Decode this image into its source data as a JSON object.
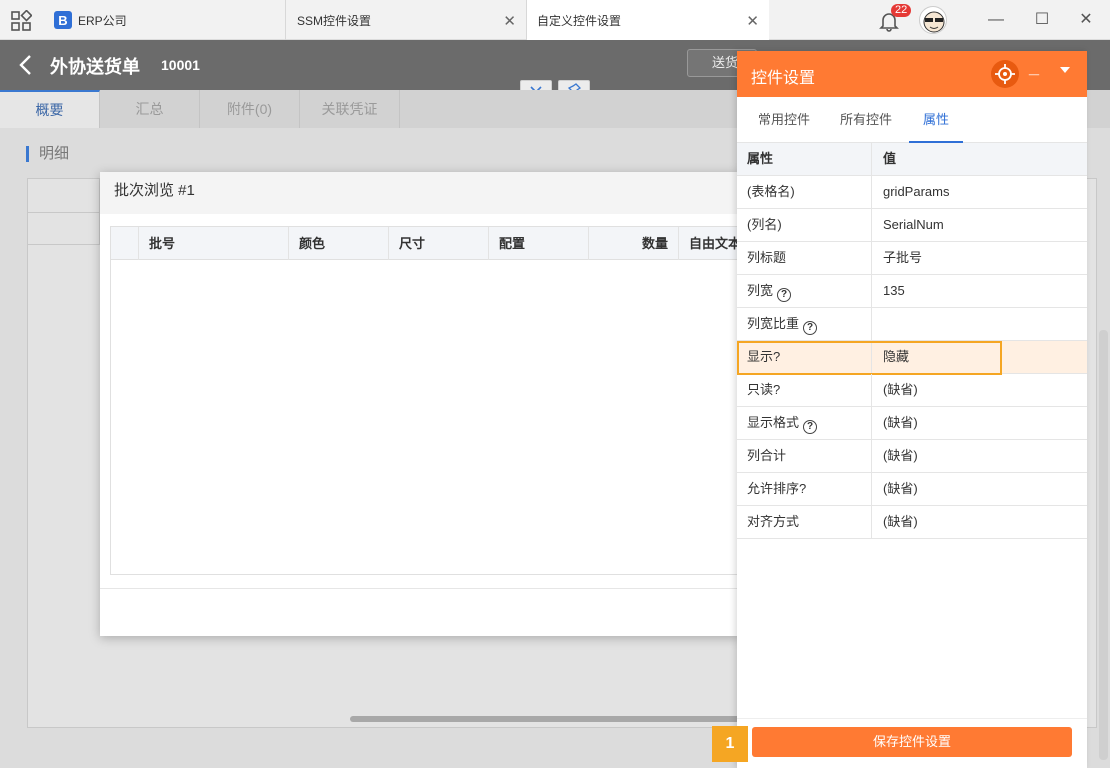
{
  "tabs": [
    {
      "label": "ERP公司",
      "logo": "B"
    },
    {
      "label": "SSM控件设置"
    },
    {
      "label": "自定义控件设置"
    }
  ],
  "notifications": {
    "count": "22"
  },
  "header": {
    "title": "外协送货单",
    "number": "10001",
    "send_label": "送货"
  },
  "page_tabs": [
    "概要",
    "汇总",
    "附件(0)",
    "关联凭证"
  ],
  "detail_label": "明细",
  "dialog": {
    "title": "批次浏览 #1",
    "columns": [
      "批号",
      "颜色",
      "尺寸",
      "配置",
      "数量",
      "自由文本"
    ]
  },
  "panel": {
    "title": "控件设置",
    "tabs": [
      "常用控件",
      "所有控件",
      "属性"
    ],
    "header_key": "属性",
    "header_value": "值",
    "rows": [
      {
        "key": "(表格名)",
        "value": "gridParams"
      },
      {
        "key": "(列名)",
        "value": "SerialNum"
      },
      {
        "key": "列标题",
        "value": "子批号"
      },
      {
        "key": "列宽",
        "value": "135",
        "help": "?"
      },
      {
        "key": "列宽比重",
        "value": "",
        "help": "?"
      },
      {
        "key": "显示?",
        "value": "隐藏"
      },
      {
        "key": "只读?",
        "value": "(缺省)"
      },
      {
        "key": "显示格式",
        "value": "(缺省)",
        "help": "?"
      },
      {
        "key": "列合计",
        "value": "(缺省)"
      },
      {
        "key": "允许排序?",
        "value": "(缺省)"
      },
      {
        "key": "对齐方式",
        "value": "(缺省)"
      }
    ],
    "save_label": "保存控件设置"
  },
  "step_marker": "1",
  "colors": {
    "accent": "#ff7a33",
    "highlight": "#f5a623",
    "link": "#2f6fd6"
  }
}
